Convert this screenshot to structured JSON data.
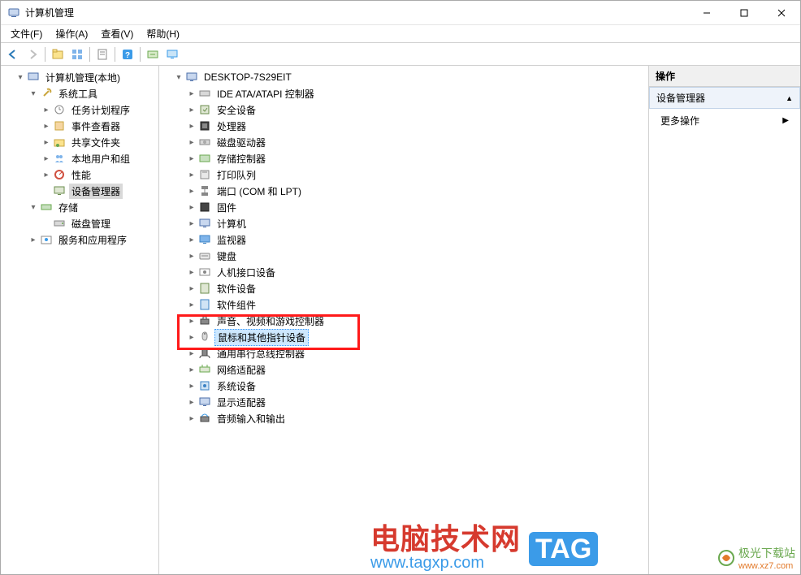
{
  "window": {
    "title": "计算机管理"
  },
  "menu": {
    "file": "文件(F)",
    "action": "操作(A)",
    "view": "查看(V)",
    "help": "帮助(H)"
  },
  "left_tree": {
    "root": "计算机管理(本地)",
    "sys_tools": "系统工具",
    "task_scheduler": "任务计划程序",
    "event_viewer": "事件查看器",
    "shared_folders": "共享文件夹",
    "local_users": "本地用户和组",
    "performance": "性能",
    "device_manager": "设备管理器",
    "storage": "存储",
    "disk_mgmt": "磁盘管理",
    "services_apps": "服务和应用程序"
  },
  "mid_tree": {
    "root": "DESKTOP-7S29EIT",
    "items": [
      "IDE ATA/ATAPI 控制器",
      "安全设备",
      "处理器",
      "磁盘驱动器",
      "存储控制器",
      "打印队列",
      "端口 (COM 和 LPT)",
      "固件",
      "计算机",
      "监视器",
      "键盘",
      "人机接口设备",
      "软件设备",
      "软件组件",
      "声音、视频和游戏控制器",
      "鼠标和其他指针设备",
      "通用串行总线控制器",
      "网络适配器",
      "系统设备",
      "显示适配器",
      "音频输入和输出"
    ],
    "selected_index": 15
  },
  "right": {
    "header": "操作",
    "item": "设备管理器",
    "more": "更多操作"
  },
  "watermark": {
    "title": "电脑技术网",
    "url": "www.tagxp.com",
    "tag": "TAG",
    "site2": "极光下载站",
    "site2url": "www.xz7.com"
  }
}
